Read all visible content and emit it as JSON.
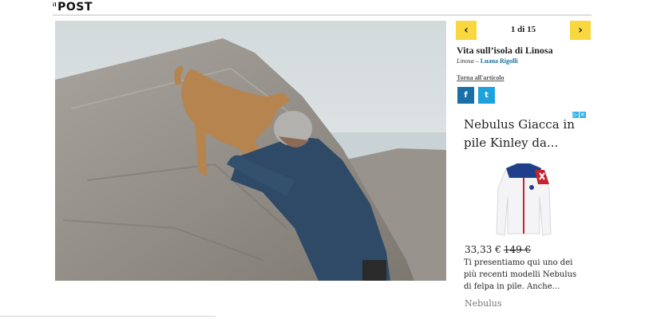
{
  "header": {
    "logo_prefix": "il",
    "logo_text": "POST"
  },
  "gallery": {
    "counter": "1 di 15",
    "prev_symbol": "‹",
    "next_symbol": "›",
    "title": "Vita sull’isola di Linosa",
    "place": "Linosa",
    "separator": "–",
    "author": "Luana Rigolli",
    "back_link": "Torna all'articolo",
    "share": [
      {
        "name": "facebook-icon",
        "glyph": "f"
      },
      {
        "name": "twitter-icon",
        "glyph": "t"
      }
    ]
  },
  "ad": {
    "title": "Nebulus Giacca in pile Kinley da...",
    "price": "33,33 €",
    "old_price": "149 €",
    "description": "Ti presentiamo qui uno dei più recenti modelli Nebulus di felpa in pile. Anche...",
    "brand": "Nebulus",
    "badge_glyphs": [
      "▷",
      "✕"
    ]
  }
}
